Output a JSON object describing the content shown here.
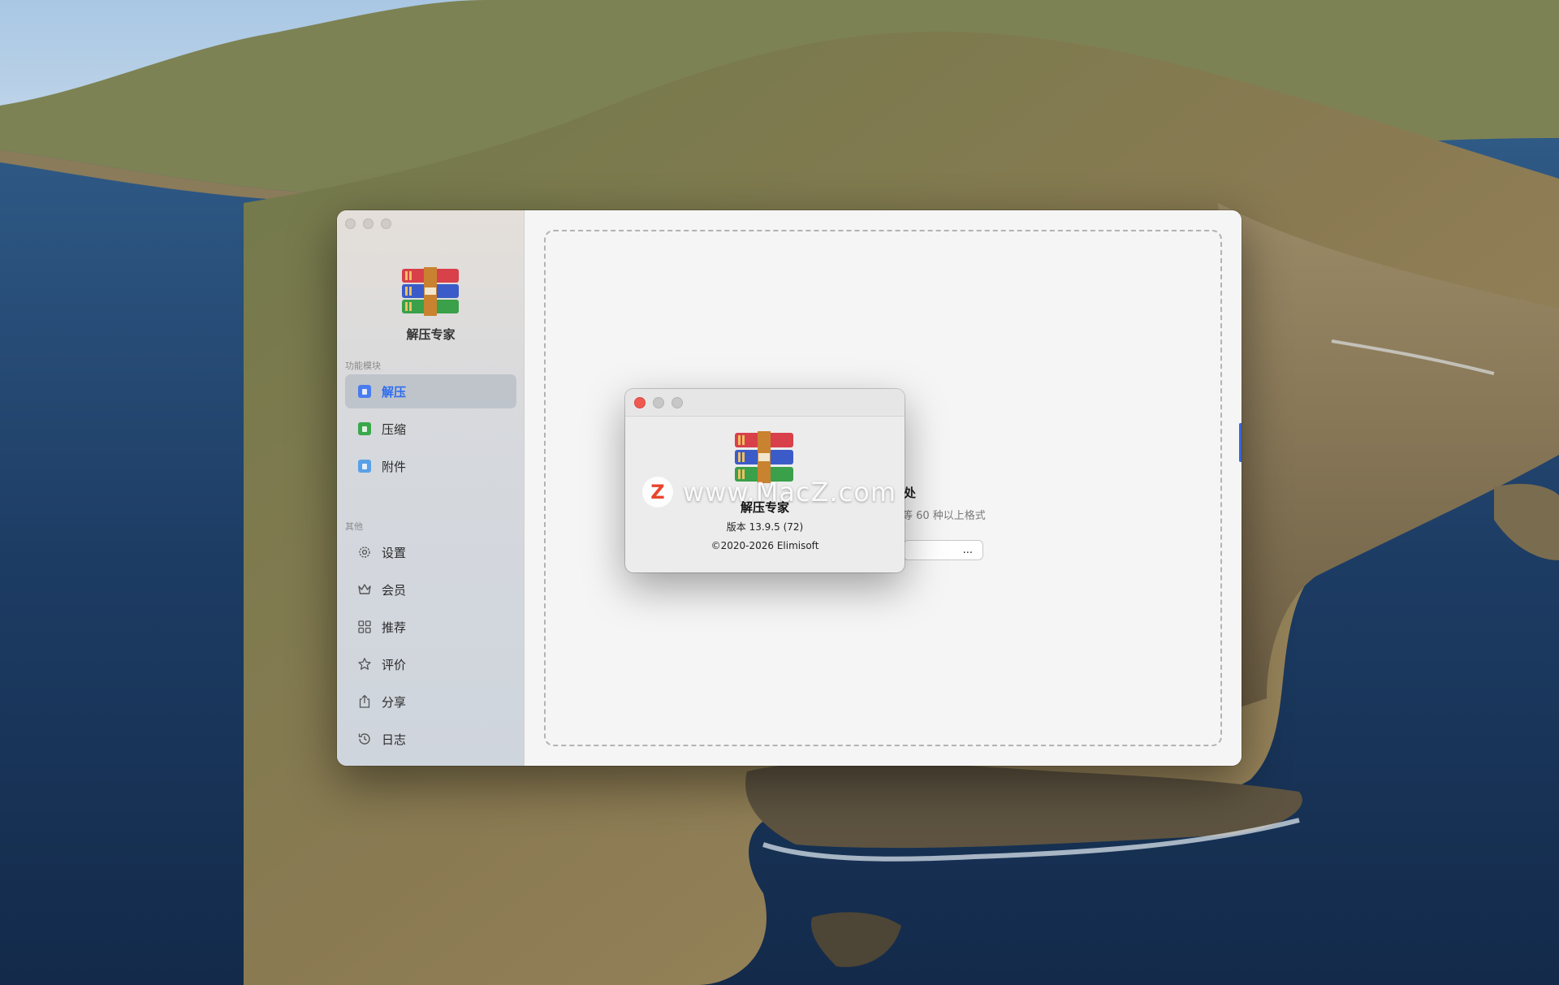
{
  "main_window": {
    "app_name": "解压专家",
    "sections": {
      "functions_label": "功能模块",
      "others_label": "其他"
    },
    "function_items": [
      {
        "label": "解压",
        "icon": "extract-icon",
        "color": "#4a7cf0",
        "active": true
      },
      {
        "label": "压缩",
        "icon": "compress-icon",
        "color": "#3aa84a",
        "active": false
      },
      {
        "label": "附件",
        "icon": "attachment-icon",
        "color": "#5aa0e8",
        "active": false
      }
    ],
    "other_items": [
      {
        "label": "设置",
        "icon": "gear-icon"
      },
      {
        "label": "会员",
        "icon": "crown-icon"
      },
      {
        "label": "推荐",
        "icon": "grid-icon"
      },
      {
        "label": "评价",
        "icon": "star-icon"
      },
      {
        "label": "分享",
        "icon": "share-icon"
      },
      {
        "label": "日志",
        "icon": "history-icon"
      }
    ],
    "drop_zone": {
      "title_partial": "拖处",
      "subtitle_partial": "等 60 种以上格式",
      "button_partial": "..."
    }
  },
  "about_dialog": {
    "app_name": "解压专家",
    "version": "版本 13.9.5 (72)",
    "copyright": "©2020-2026 Elimisoft"
  },
  "watermark": {
    "badge": "Z",
    "text": "www.MacZ.com"
  },
  "colors": {
    "accent_blue": "#2e6df0",
    "close_red": "#ee5a52",
    "inactive_dot": "#c7c7c7"
  }
}
